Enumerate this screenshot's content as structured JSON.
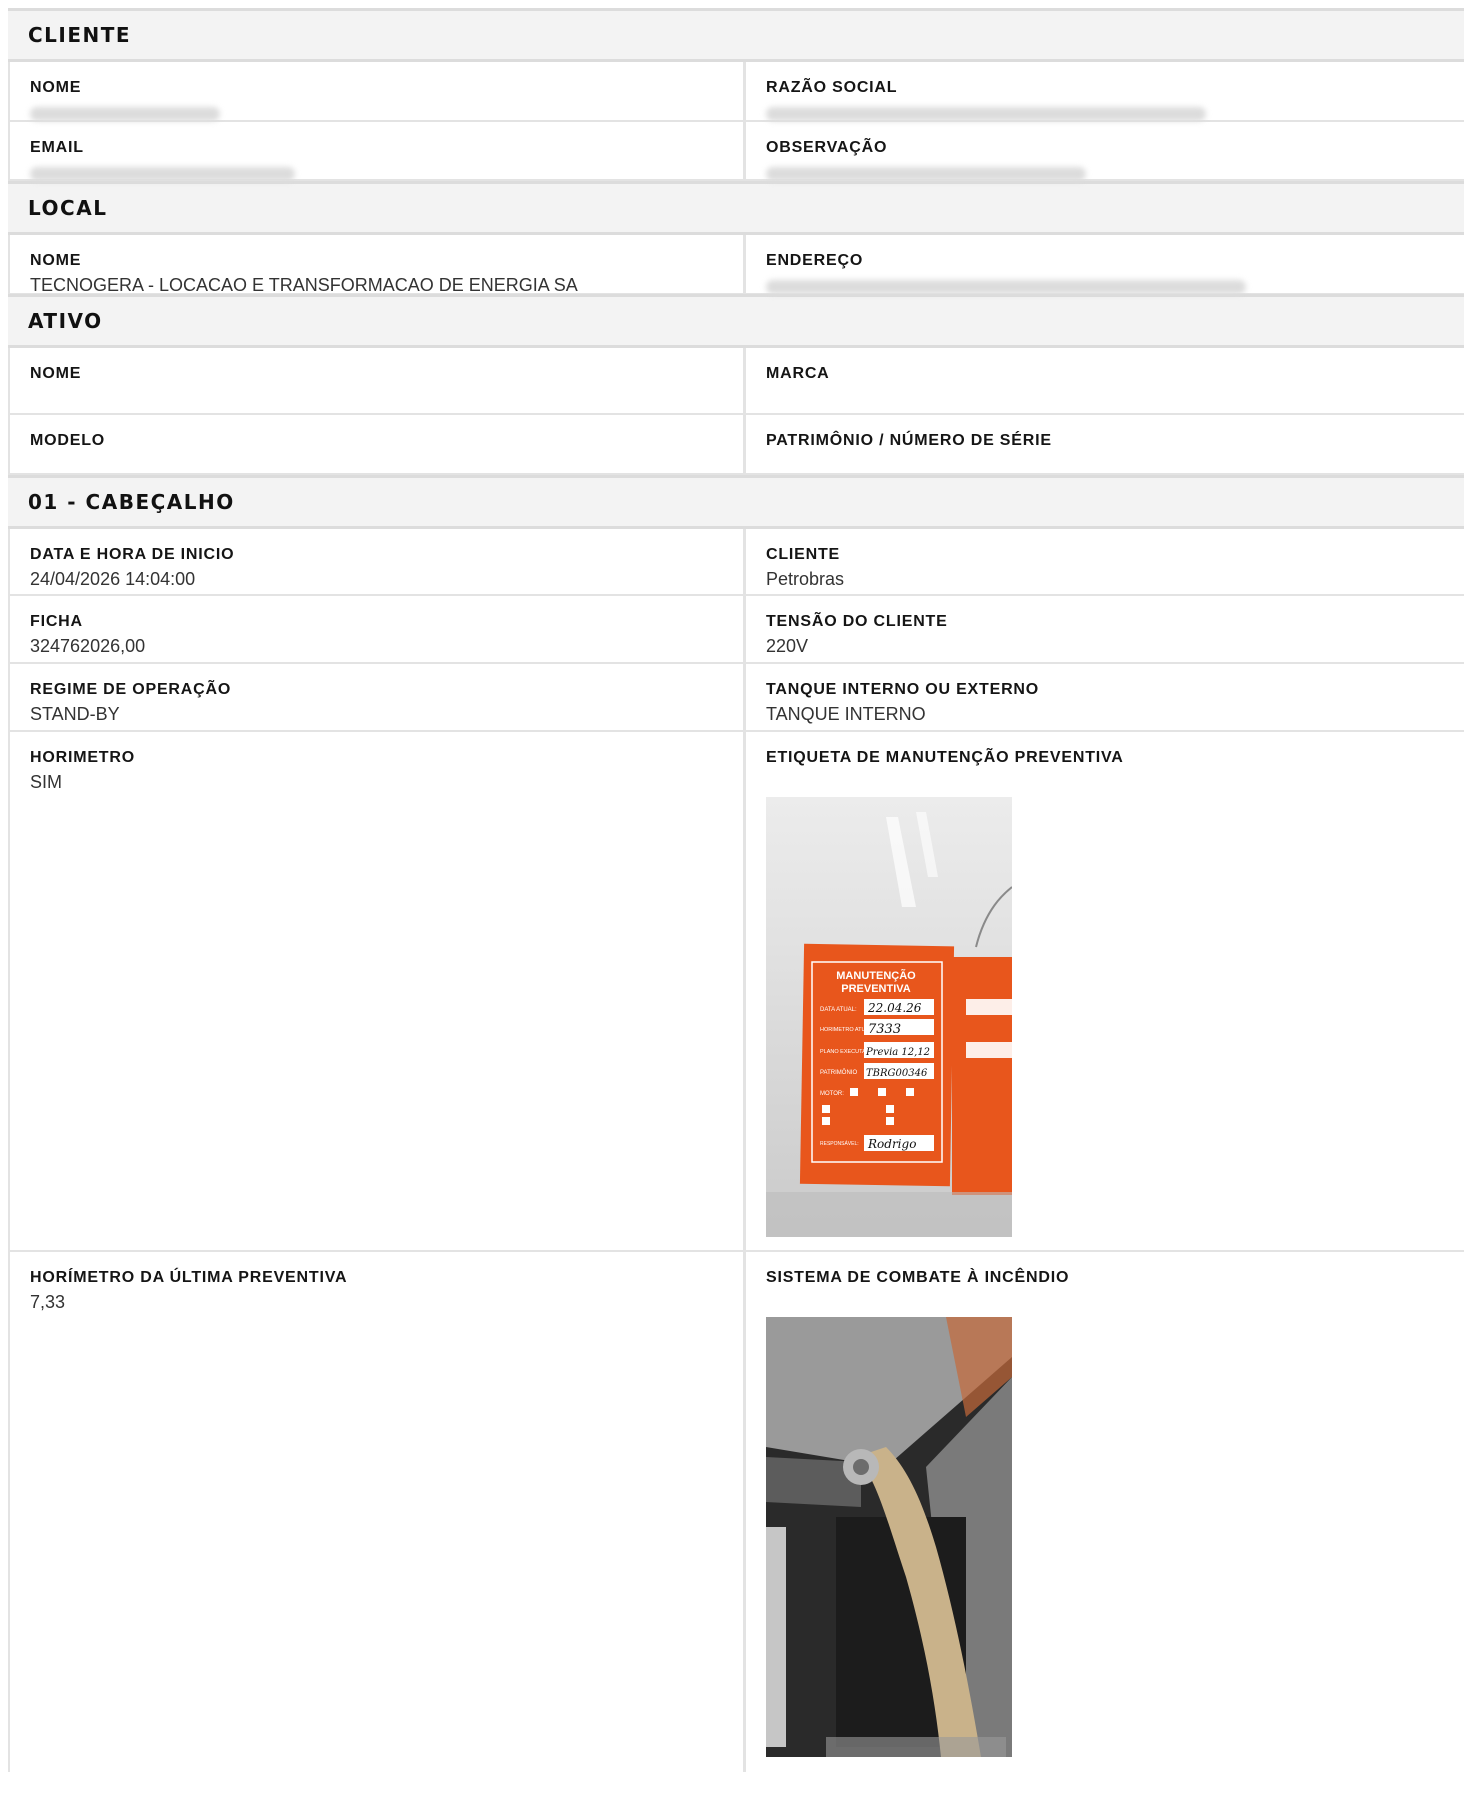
{
  "sections": {
    "cliente": {
      "title": "CLIENTE",
      "nome_label": "NOME",
      "razao_label": "RAZÃO SOCIAL",
      "email_label": "EMAIL",
      "observacao_label": "OBSERVAÇÃO"
    },
    "local": {
      "title": "LOCAL",
      "nome_label": "NOME",
      "nome_value": "TECNOGERA - LOCACAO E TRANSFORMACAO DE ENERGIA SA",
      "endereco_label": "ENDEREÇO"
    },
    "ativo": {
      "title": "ATIVO",
      "nome_label": "NOME",
      "marca_label": "MARCA",
      "modelo_label": "MODELO",
      "patrimonio_label": "PATRIMÔNIO / NÚMERO DE SÉRIE"
    },
    "cabecalho": {
      "title": "01 - CABEÇALHO",
      "fields": {
        "data_label": "DATA E HORA DE INICIO",
        "data_value": "24/04/2026 14:04:00",
        "cliente_label": "CLIENTE",
        "cliente_value": "Petrobras",
        "ficha_label": "FICHA",
        "ficha_value": "324762026,00",
        "tensao_label": "TENSÃO DO CLIENTE",
        "tensao_value": "220V",
        "regime_label": "REGIME DE OPERAÇÃO",
        "regime_value": "STAND-BY",
        "tanque_label": "TANQUE INTERNO OU EXTERNO",
        "tanque_value": "TANQUE INTERNO",
        "horimetro_label": "HORIMETRO",
        "horimetro_value": "SIM",
        "etiqueta_label": "ETIQUETA DE MANUTENÇÃO PREVENTIVA",
        "ultima_label": "HORÍMETRO DA ÚLTIMA PREVENTIVA",
        "ultima_value": "7,33",
        "incendio_label": "SISTEMA DE COMBATE À INCÊNDIO"
      }
    }
  },
  "photo1": {
    "title_line1": "MANUTENÇÃO",
    "title_line2": "PREVENTIVA",
    "data_atual_label": "DATA ATUAL:",
    "data_atual": "22.04.26",
    "horimetro_label": "HORIMETRO ATUAL",
    "horimetro": "7333",
    "plano_label": "PLANO EXECUTADO",
    "plano": "Previa 12,12",
    "patrimonio_label": "PATRIMÔNIO",
    "patrimonio": "TBRG00346",
    "motor_label": "MOTOR:",
    "responsavel_label": "RESPONSÁVEL:",
    "responsavel": "Rodrigo"
  },
  "colors": {
    "header_bg": "#f3f3f3",
    "border": "#dcdcdc",
    "label_orange": "#e85a1c"
  }
}
